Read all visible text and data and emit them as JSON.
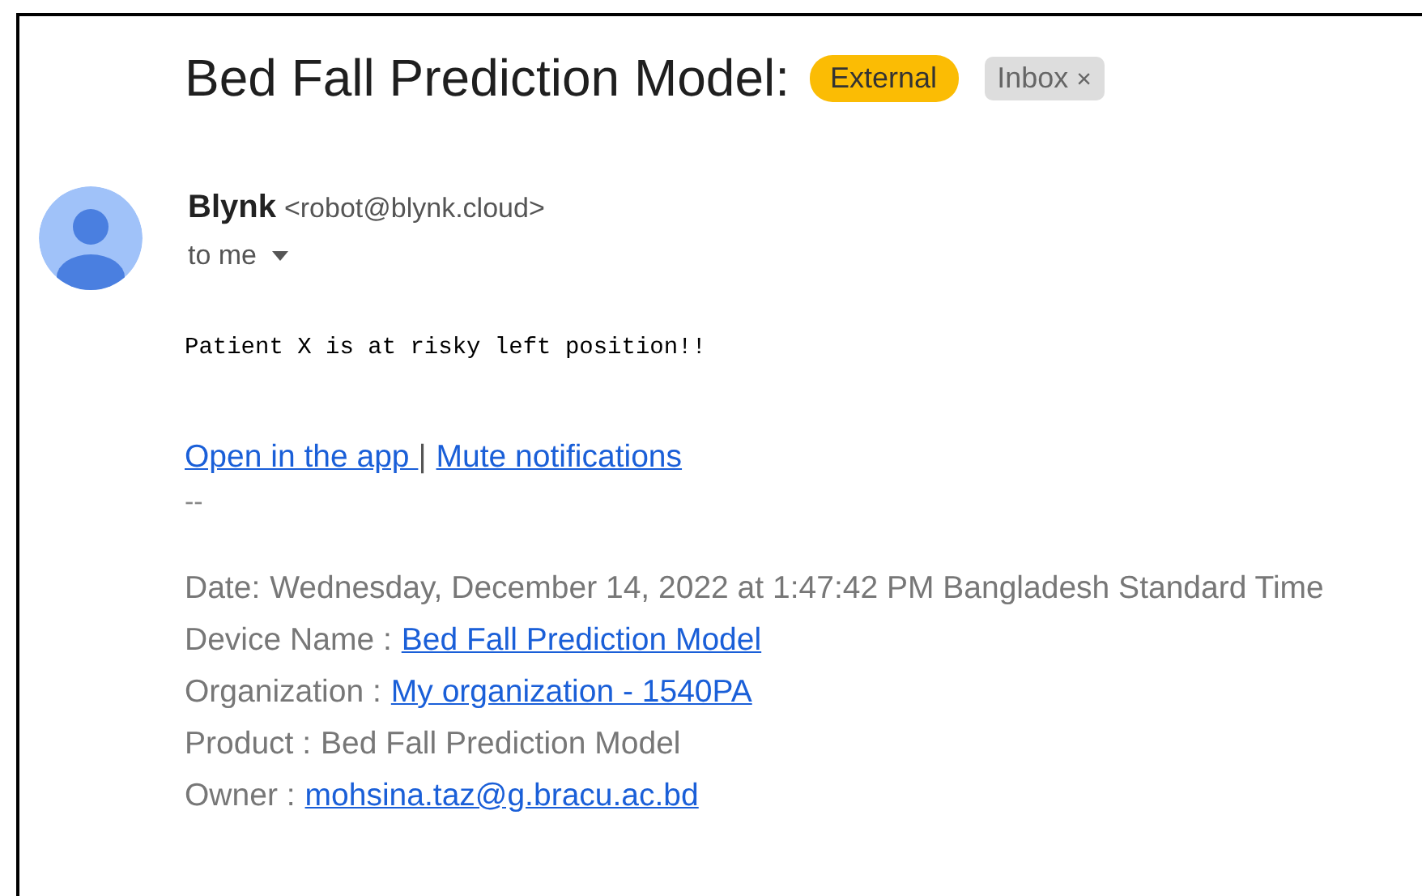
{
  "subject": "Bed Fall Prediction Model:",
  "labels": [
    {
      "kind": "external",
      "text": "External"
    },
    {
      "kind": "inbox",
      "text": "Inbox",
      "close": "×"
    }
  ],
  "sender": {
    "name": "Blynk",
    "address": "<robot@blynk.cloud>",
    "recipient": "to me"
  },
  "body": {
    "message": "Patient X is at risky left position!!",
    "links": [
      {
        "text": "Open in the app "
      },
      {
        "text": "Mute notifications"
      }
    ],
    "separator": "|",
    "signature_dash": "--",
    "details": [
      {
        "label": "Date:",
        "value": "Wednesday, December 14, 2022 at 1:47:42 PM Bangladesh Standard Time",
        "kind": "text"
      },
      {
        "label": "Device Name :",
        "value": "Bed Fall Prediction Model",
        "kind": "link"
      },
      {
        "label": "Organization :",
        "value": "My organization - 1540PA",
        "kind": "link"
      },
      {
        "label": "Product :",
        "value": "Bed Fall Prediction Model",
        "kind": "text"
      },
      {
        "label": "Owner :",
        "value": "mohsina.taz@g.bracu.ac.bd",
        "kind": "link"
      }
    ]
  }
}
